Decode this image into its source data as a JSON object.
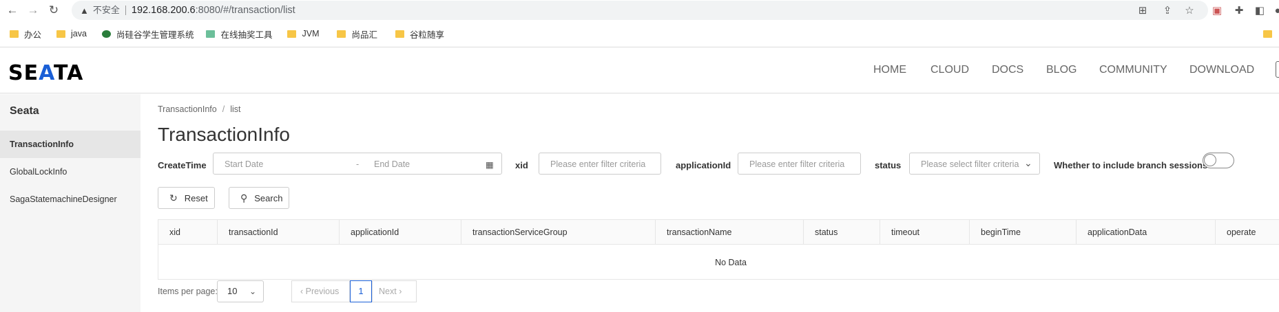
{
  "browser": {
    "warning_label": "不安全",
    "url_host": "192.168.200.6",
    "url_path": ":8080/#/transaction/list",
    "bookmarks": [
      {
        "label": "办公"
      },
      {
        "label": "java"
      },
      {
        "label": "尚硅谷学生管理系统"
      },
      {
        "label": "在线抽奖工具"
      },
      {
        "label": "JVM"
      },
      {
        "label": "尚品汇"
      },
      {
        "label": "谷粒随享"
      }
    ]
  },
  "header": {
    "logo": "SEATA",
    "nav": [
      "HOME",
      "CLOUD",
      "DOCS",
      "BLOG",
      "COMMUNITY",
      "DOWNLOAD"
    ]
  },
  "sidebar": {
    "title": "Seata",
    "items": [
      {
        "label": "TransactionInfo",
        "active": true
      },
      {
        "label": "GlobalLockInfo",
        "active": false
      },
      {
        "label": "SagaStatemachineDesigner",
        "active": false
      }
    ]
  },
  "breadcrumb": {
    "items": [
      "TransactionInfo",
      "list"
    ]
  },
  "page_title": "TransactionInfo",
  "filters": {
    "create_time_label": "CreateTime",
    "start_placeholder": "Start Date",
    "range_sep": "-",
    "end_placeholder": "End Date",
    "xid_label": "xid",
    "xid_placeholder": "Please enter filter criteria",
    "app_label": "applicationId",
    "app_placeholder": "Please enter filter criteria",
    "status_label": "status",
    "status_placeholder": "Please select filter criteria",
    "branch_label": "Whether to include branch sessions",
    "branch_enabled": false
  },
  "buttons": {
    "reset": "Reset",
    "search": "Search"
  },
  "table": {
    "columns": [
      "xid",
      "transactionId",
      "applicationId",
      "transactionServiceGroup",
      "transactionName",
      "status",
      "timeout",
      "beginTime",
      "applicationData",
      "operate"
    ],
    "empty_text": "No Data"
  },
  "pagination": {
    "items_per_page_label": "Items per page:",
    "page_size": "10",
    "previous": "Previous",
    "current_page": "1",
    "next": "Next"
  }
}
